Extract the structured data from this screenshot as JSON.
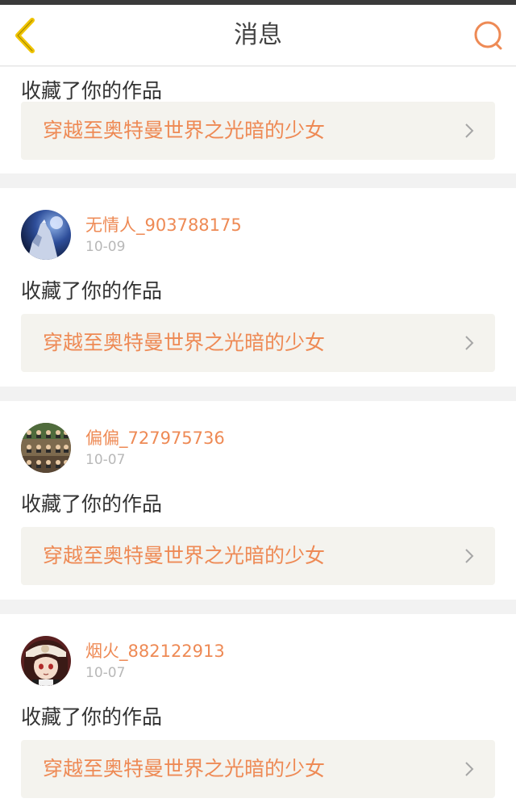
{
  "header": {
    "title": "消息"
  },
  "notifications": [
    {
      "action": "收藏了你的作品",
      "work_title": "穿越至奥特曼世界之光暗的少女"
    },
    {
      "username": "无情人_903788175",
      "date": "10-09",
      "action": "收藏了你的作品",
      "work_title": "穿越至奥特曼世界之光暗的少女"
    },
    {
      "username": "偏偏_727975736",
      "date": "10-07",
      "action": "收藏了你的作品",
      "work_title": "穿越至奥特曼世界之光暗的少女"
    },
    {
      "username": "烟火_882122913",
      "date": "10-07",
      "action": "收藏了你的作品",
      "work_title": "穿越至奥特曼世界之光暗的少女"
    }
  ],
  "colors": {
    "accent": "#ee8a55",
    "back_icon": "#f0c400",
    "page_background": "#f2f2f2",
    "link_background": "#f4f3ee"
  },
  "icons": {
    "back": "chevron-left-icon",
    "search": "search-icon",
    "item_arrow": "chevron-right-icon"
  }
}
